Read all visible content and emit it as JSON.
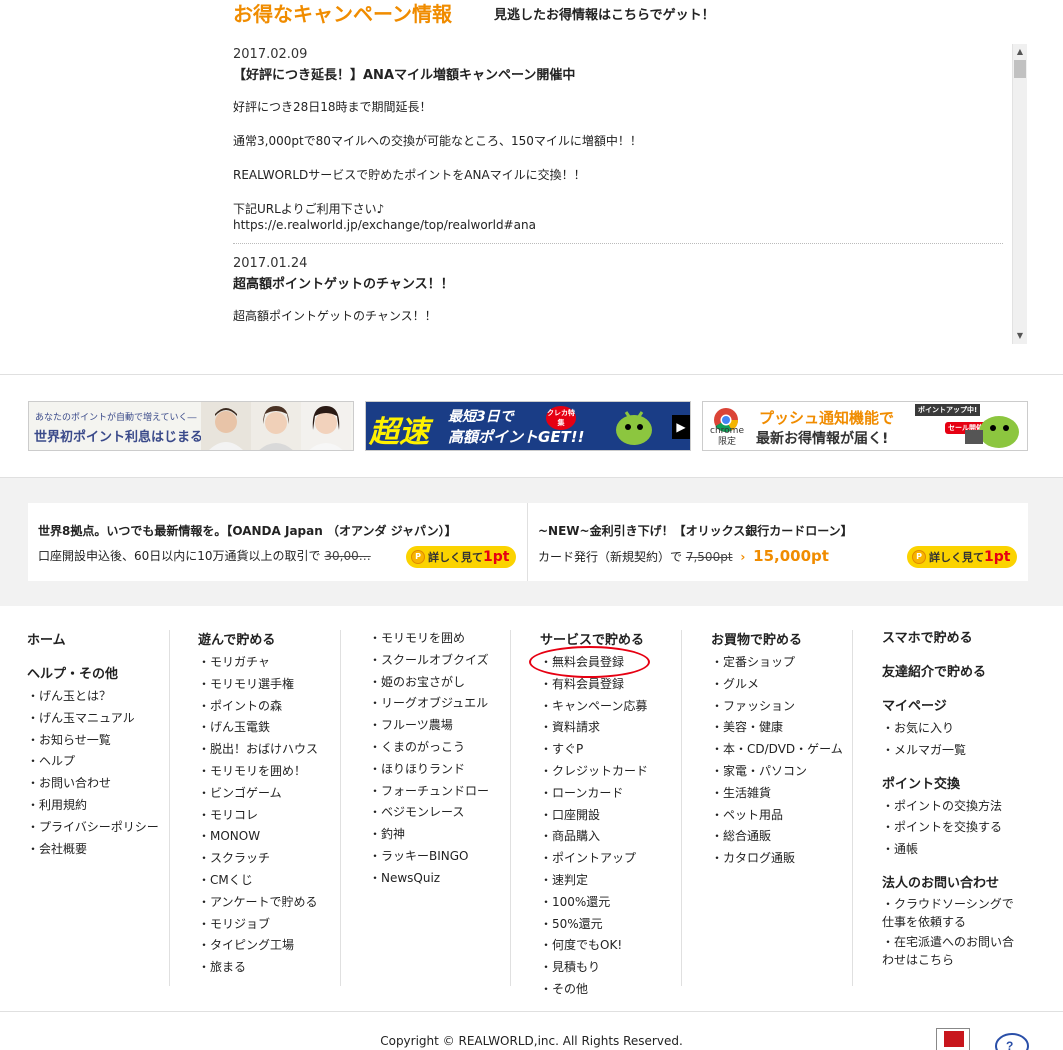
{
  "campaign": {
    "title": "お得なキャンペーン情報",
    "subtitle": "見逃したお得情報はこちらでゲット！",
    "items": [
      {
        "date": "2017.02.09",
        "title": "【好評につき延長！】ANAマイル増額キャンペーン開催中",
        "p1": "好評につき28日18時まで期間延長！",
        "p2": "通常3,000ptで80マイルへの交換が可能なところ、150マイルに増額中！！",
        "p3": "REALWORLDサービスで貯めたポイントをANAマイルに交換！！",
        "p4": "下記URLよりご利用下さい♪",
        "url": "https://e.realworld.jp/exchange/top/realworld#ana"
      },
      {
        "date": "2017.01.24",
        "title": "超高額ポイントゲットのチャンス！！",
        "p1": "超高額ポイントゲットのチャンス！！"
      }
    ]
  },
  "banners": {
    "b1": {
      "small": "あなたのポイントが自動で増えていく―",
      "big": "世界初ポイント利息はじまる。"
    },
    "b2": {
      "big": "超速",
      "line1": "最短3日で",
      "line2": "高額ポイントGET!!",
      "badge": "クレカ特集"
    },
    "b3": {
      "chrome": "chrome 限定",
      "line1": "プッシュ通知機能で",
      "line2": "最新お得情報が届く!",
      "badge1": "ポイントアップ中!",
      "badge2": "セール開催中!"
    }
  },
  "offers": [
    {
      "title": "世界8拠点。いつでも最新情報を。【OANDA Japan （オアンダ ジャパン）】",
      "desc": "口座開設申込後、60日以内に10万通貨以上の取引で",
      "old": "30,00…",
      "btn_label": "詳しく見て",
      "btn_pt": "1pt"
    },
    {
      "title": "~NEW~金利引き下げ！【オリックス銀行カードローン】",
      "desc": "カード発行（新規契約）で",
      "old": "7,500pt",
      "arrow": "›",
      "new": "15,000pt",
      "btn_label": "詳しく見て",
      "btn_pt": "1pt"
    }
  ],
  "footer": {
    "col1": {
      "home": "ホーム",
      "help_head": "ヘルプ・その他",
      "items": [
        "・げん玉とは？",
        "・げん玉マニュアル",
        "・お知らせ一覧",
        "・ヘルプ",
        "・お問い合わせ",
        "・利用規約",
        "・プライバシーポリシー",
        "・会社概要"
      ]
    },
    "col2": {
      "head": "遊んで貯める",
      "items": [
        "・モリガチャ",
        "・モリモリ選手権",
        "・ポイントの森",
        "・げん玉電鉄",
        "・脱出！おばけハウス",
        "・モリモリを囲め！",
        "・ビンゴゲーム",
        "・モリコレ",
        "・MONOW",
        "・スクラッチ",
        "・CMくじ",
        "・アンケートで貯める",
        "・モリジョブ",
        "・タイピング工場",
        "・旅まる"
      ]
    },
    "col3": {
      "items": [
        "・モリモリを囲め",
        "・スクールオブクイズ",
        "・姫のお宝さがし",
        "・リーグオブジュエル",
        "・フルーツ農場",
        "・くまのがっこう",
        "・ほりほりランド",
        "・フォーチュンドロー",
        "・ベジモンレース",
        "・釣神",
        "・ラッキーBINGO",
        "・NewsQuiz"
      ]
    },
    "col4": {
      "head": "サービスで貯める",
      "items": [
        "・無料会員登録",
        "・有料会員登録",
        "・キャンペーン応募",
        "・資料請求",
        "・すぐP",
        "・クレジットカード",
        "・ローンカード",
        "・口座開設",
        "・商品購入",
        "・ポイントアップ",
        "・速判定",
        "・100%還元",
        "・50%還元",
        "・何度でもOK!",
        "・見積もり",
        "・その他"
      ]
    },
    "col5": {
      "head": "お買物で貯める",
      "items": [
        "・定番ショップ",
        "・グルメ",
        "・ファッション",
        "・美容・健康",
        "・本・CD/DVD・ゲーム",
        "・家電・パソコン",
        "・生活雑貨",
        "・ペット用品",
        "・総合通販",
        "・カタログ通販"
      ]
    },
    "col6": {
      "smartphone": "スマホで貯める",
      "friend": "友達紹介で貯める",
      "mypage": "マイページ",
      "mypage_items": [
        "・お気に入り",
        "・メルマガ一覧"
      ],
      "exchange": "ポイント交換",
      "exchange_items": [
        "・ポイントの交換方法",
        "・ポイントを交換する",
        "・通帳"
      ],
      "corp": "法人のお問い合わせ",
      "corp_items": [
        "・クラウドソーシングで仕事を依頼する",
        "・在宅派遣へのお問い合わせはこちら"
      ]
    }
  },
  "copyright": "Copyright © REALWORLD,inc. All Rights Reserved.",
  "colors": {
    "accent": "#f08c00",
    "button": "#fbd300",
    "highlight": "#e60012"
  }
}
